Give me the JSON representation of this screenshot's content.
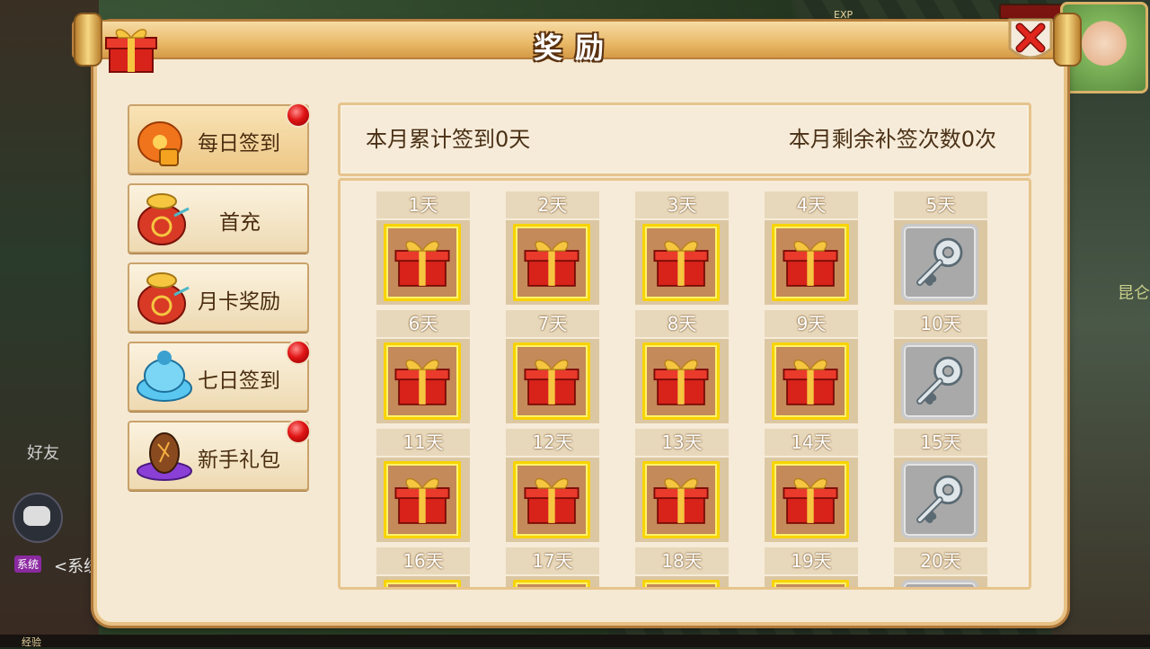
{
  "panel": {
    "title": "奖励"
  },
  "hud": {
    "exp_label": "EXP",
    "friends_label": "好友",
    "system_tag": "系统",
    "system_prefix": "<系统",
    "bottom_label": "经验",
    "side_text": "昆仑"
  },
  "sidebar": {
    "items": [
      {
        "label": "每日签到",
        "icon": "money-bag-icon",
        "red_dot": true,
        "active": true
      },
      {
        "label": "首充",
        "icon": "coin-sack-icon",
        "red_dot": false,
        "active": false
      },
      {
        "label": "月卡奖励",
        "icon": "coin-sack-icon",
        "red_dot": false,
        "active": false
      },
      {
        "label": "七日签到",
        "icon": "blue-treasure-icon",
        "red_dot": true,
        "active": false
      },
      {
        "label": "新手礼包",
        "icon": "egg-altar-icon",
        "red_dot": true,
        "active": false
      }
    ]
  },
  "signin": {
    "total_text": "本月累计签到0天",
    "remaining_text": "本月剩余补签次数0次",
    "days": [
      {
        "label": "1天",
        "reward": "gift-box"
      },
      {
        "label": "2天",
        "reward": "gift-box"
      },
      {
        "label": "3天",
        "reward": "gift-box"
      },
      {
        "label": "4天",
        "reward": "gift-box"
      },
      {
        "label": "5天",
        "reward": "key"
      },
      {
        "label": "6天",
        "reward": "gift-box"
      },
      {
        "label": "7天",
        "reward": "gift-box"
      },
      {
        "label": "8天",
        "reward": "gift-box"
      },
      {
        "label": "9天",
        "reward": "gift-box"
      },
      {
        "label": "10天",
        "reward": "key"
      },
      {
        "label": "11天",
        "reward": "gift-box"
      },
      {
        "label": "12天",
        "reward": "gift-box"
      },
      {
        "label": "13天",
        "reward": "gift-box"
      },
      {
        "label": "14天",
        "reward": "gift-box"
      },
      {
        "label": "15天",
        "reward": "key"
      },
      {
        "label": "16天",
        "reward": "gift-box"
      },
      {
        "label": "17天",
        "reward": "gift-box"
      },
      {
        "label": "18天",
        "reward": "gift-box"
      },
      {
        "label": "19天",
        "reward": "gift-box"
      },
      {
        "label": "20天",
        "reward": "key"
      }
    ]
  },
  "colors": {
    "panel_bg": "#f5e9d3",
    "gold_frame": "#f7d300",
    "red_dot": "#e01414",
    "text_brown": "#4a3016"
  }
}
